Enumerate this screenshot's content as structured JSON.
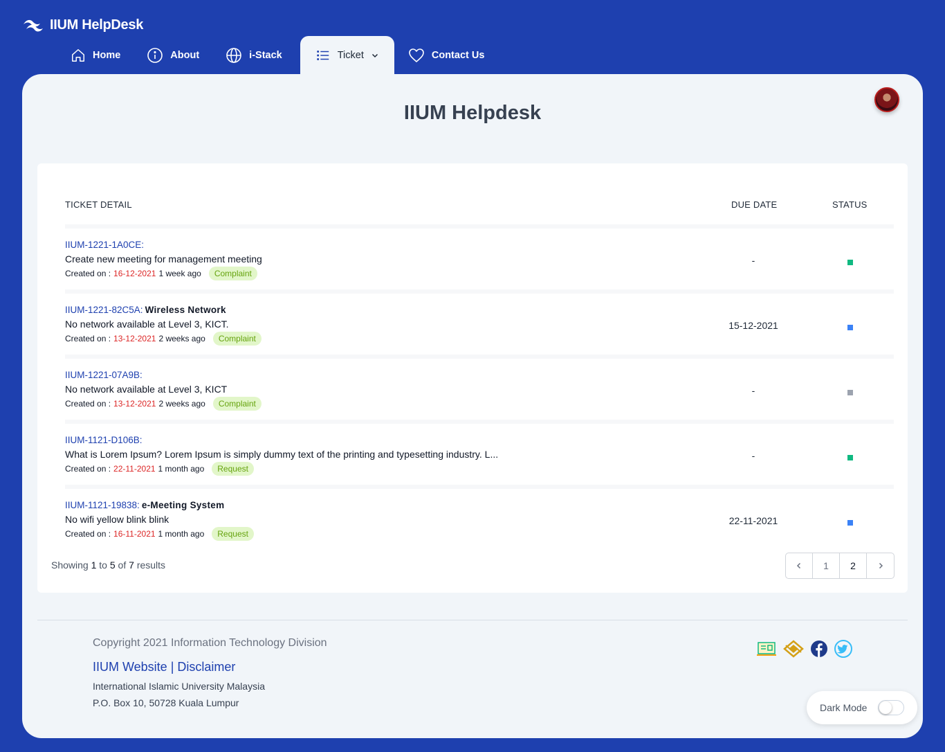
{
  "brand": {
    "name": "IIUM HelpDesk"
  },
  "nav": {
    "items": [
      {
        "label": "Home",
        "icon": "home-icon"
      },
      {
        "label": "About",
        "icon": "info-icon"
      },
      {
        "label": "i-Stack",
        "icon": "globe-icon"
      },
      {
        "label": "Ticket",
        "icon": "list-icon",
        "active": true
      },
      {
        "label": "Contact Us",
        "icon": "heart-icon"
      }
    ]
  },
  "page": {
    "title": "IIUM Helpdesk"
  },
  "table": {
    "headers": {
      "detail": "TICKET DETAIL",
      "due": "DUE DATE",
      "status": "STATUS"
    },
    "created_label": "Created on :",
    "rows": [
      {
        "id": "IIUM-1221-1A0CE:",
        "title": "",
        "desc": "Create new meeting for management meeting",
        "date": "16-12-2021",
        "ago": "1 week ago",
        "type": "Complaint",
        "due": "-",
        "status_color": "#10b981"
      },
      {
        "id": "IIUM-1221-82C5A:",
        "title": "Wireless Network",
        "desc": "No network available at Level 3, KICT.",
        "date": "13-12-2021",
        "ago": "2 weeks ago",
        "type": "Complaint",
        "due": "15-12-2021",
        "status_color": "#3b82f6"
      },
      {
        "id": "IIUM-1221-07A9B:",
        "title": "",
        "desc": "No network available at Level 3, KICT",
        "date": "13-12-2021",
        "ago": "2 weeks ago",
        "type": "Complaint",
        "due": "-",
        "status_color": "#9ca3af"
      },
      {
        "id": "IIUM-1121-D106B:",
        "title": "",
        "desc": "What is Lorem Ipsum? Lorem Ipsum is simply dummy text of the printing and typesetting industry. L...",
        "date": "22-11-2021",
        "ago": "1 month ago",
        "type": "Request",
        "due": "-",
        "status_color": "#10b981"
      },
      {
        "id": "IIUM-1121-19838:",
        "title": "e-Meeting System",
        "desc": "No wifi yellow blink blink",
        "date": "16-11-2021",
        "ago": "1 month ago",
        "type": "Request",
        "due": "22-11-2021",
        "status_color": "#3b82f6"
      }
    ]
  },
  "pagination": {
    "showing_prefix": "Showing",
    "from": "1",
    "to_word": "to",
    "to": "5",
    "of_word": "of",
    "total": "7",
    "suffix": "results",
    "pages": [
      "1",
      "2"
    ],
    "current": "2"
  },
  "footer": {
    "copyright": "Copyright 2021 Information Technology Division",
    "link_website": "IIUM Website",
    "separator": "|",
    "link_disclaimer": "Disclaimer",
    "address_line1": "International Islamic University Malaysia",
    "address_line2": "P.O. Box 10, 50728 Kuala Lumpur",
    "dark_mode_label": "Dark Mode"
  },
  "colors": {
    "primary": "#1e40af",
    "panel": "#f1f5f9",
    "date_red": "#dc2626",
    "badge_bg": "#e2f6c9",
    "badge_text": "#65a30d"
  }
}
